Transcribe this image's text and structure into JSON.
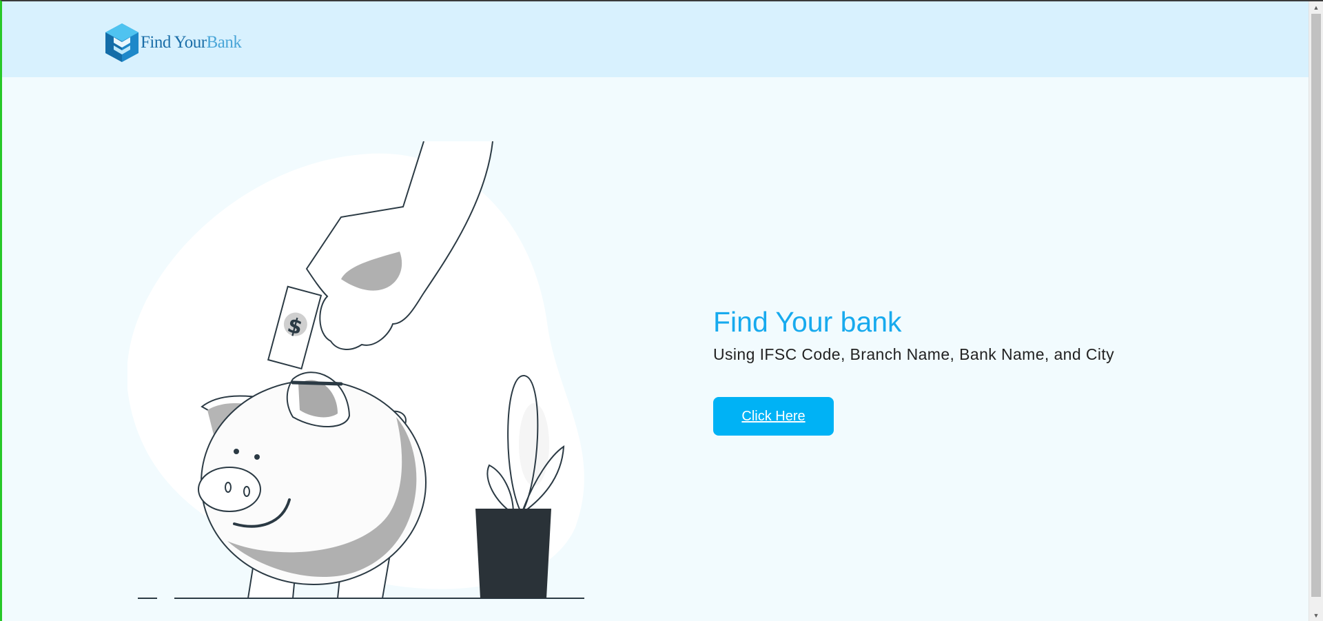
{
  "brand": {
    "name_part1": "Find Your",
    "name_part2": "Bank"
  },
  "hero": {
    "title": "Find Your bank",
    "subtitle": "Using IFSC Code, Branch Name, Bank Name, and City",
    "cta_label": "Click Here"
  },
  "icons": {
    "logo": "cube-logo-icon",
    "illustration": "piggy-bank-illustration",
    "scroll_up": "scroll-up-arrow-icon",
    "scroll_down": "scroll-down-arrow-icon"
  },
  "colors": {
    "header_bg": "#d8f1fe",
    "page_bg": "#f2fbfe",
    "accent": "#17aaee",
    "button_bg": "#00b2f5",
    "logo_dark": "#1b6ea8",
    "logo_light": "#4aa6d8"
  }
}
